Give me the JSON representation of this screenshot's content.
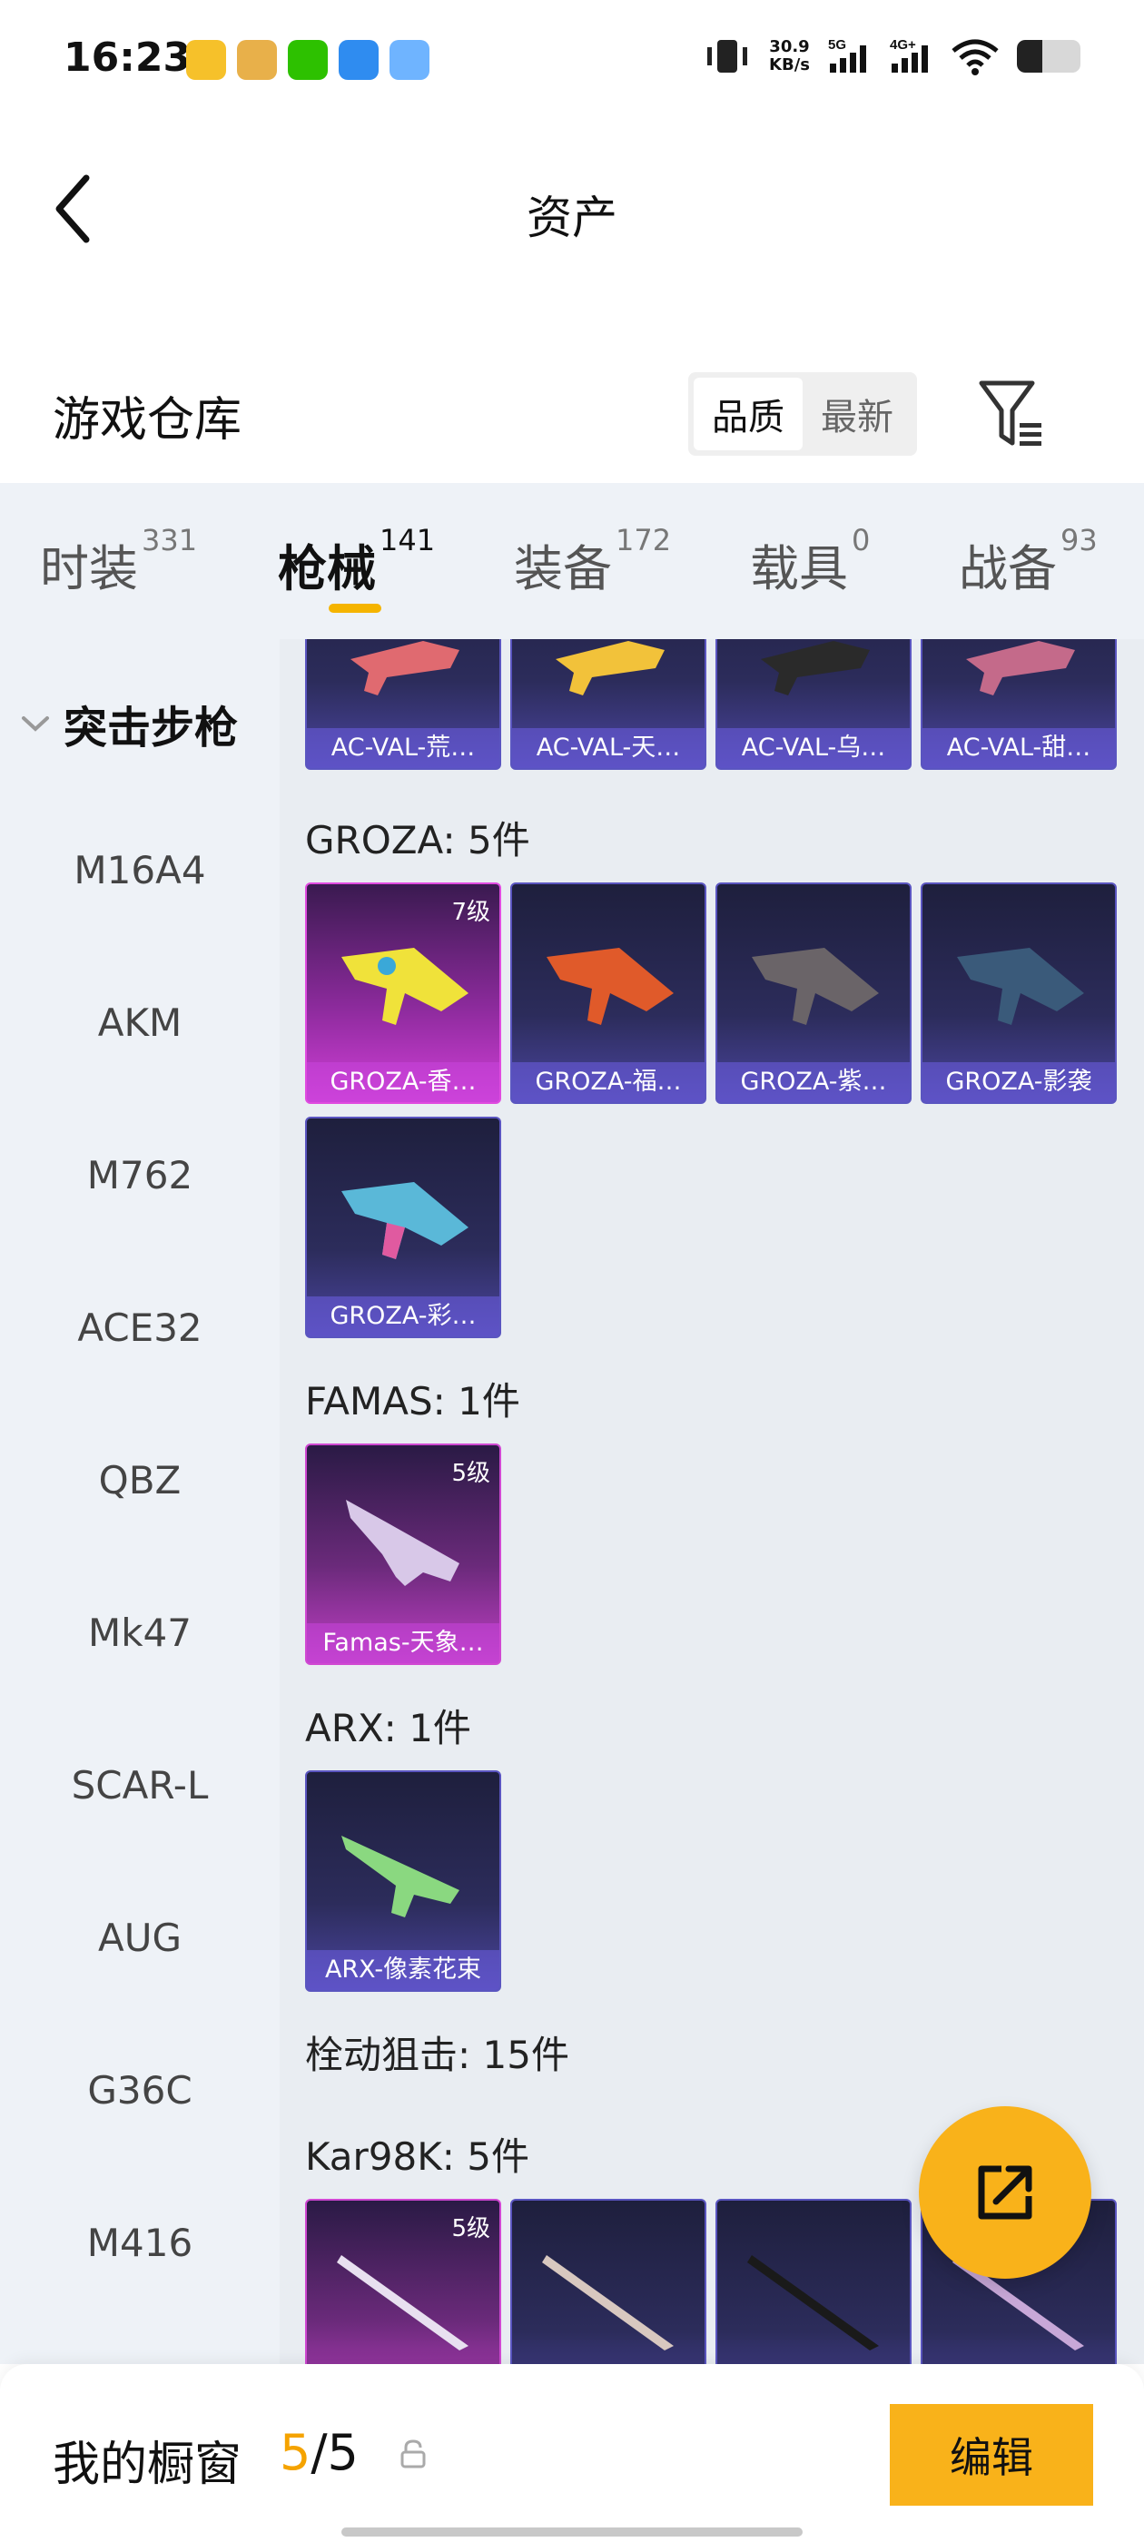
{
  "status": {
    "time": "16:23",
    "speed_value": "30.9",
    "speed_unit": "KB/s",
    "net1": "5G",
    "net2": "4G+",
    "battery_level": 0.4
  },
  "header": {
    "title": "资产"
  },
  "warehouse": {
    "title": "游戏仓库",
    "sort_options": [
      "品质",
      "最新"
    ],
    "active_sort": "品质"
  },
  "category_tabs": [
    {
      "label": "时装",
      "count": "331"
    },
    {
      "label": "枪械",
      "count": "141",
      "active": true
    },
    {
      "label": "装备",
      "count": "172"
    },
    {
      "label": "载具",
      "count": "0"
    },
    {
      "label": "战备",
      "count": "93"
    }
  ],
  "sidebar": {
    "group": "突击步枪",
    "items": [
      "M16A4",
      "AKM",
      "M762",
      "ACE32",
      "QBZ",
      "Mk47",
      "SCAR-L",
      "AUG",
      "G36C",
      "M416"
    ]
  },
  "content": {
    "top_cards": [
      "AC-VAL-荒…",
      "AC-VAL-天…",
      "AC-VAL-乌…",
      "AC-VAL-甜…"
    ],
    "groza_title": "GROZA: 5件",
    "groza_cards": [
      {
        "name": "GROZA-香…",
        "level": "7级"
      },
      {
        "name": "GROZA-福…"
      },
      {
        "name": "GROZA-紫…"
      },
      {
        "name": "GROZA-影袭"
      },
      {
        "name": "GROZA-彩…"
      }
    ],
    "famas_title": "FAMAS: 1件",
    "famas_cards": [
      {
        "name": "Famas-天象…",
        "level": "5级"
      }
    ],
    "arx_title": "ARX: 1件",
    "arx_cards": [
      {
        "name": "ARX-像素花束"
      }
    ],
    "bolt_title": "栓动狙击: 15件",
    "kar_title": "Kar98K: 5件",
    "kar_cards": [
      {
        "level": "5级"
      }
    ]
  },
  "bottom": {
    "label": "我的橱窗",
    "current": "5",
    "total": "/5",
    "edit_label": "编辑"
  },
  "colors": {
    "accent": "#f9b21a",
    "tab_underline": "#f5b400",
    "count_highlight": "#f5a300"
  }
}
